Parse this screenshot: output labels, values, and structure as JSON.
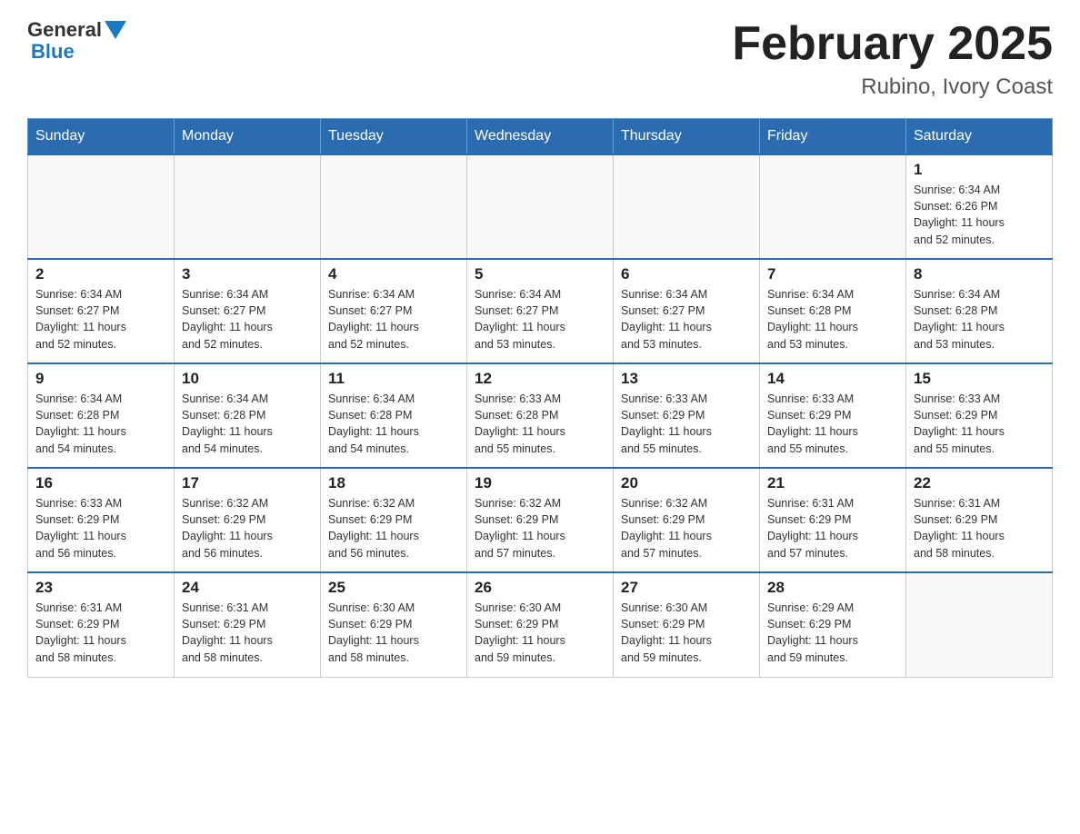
{
  "header": {
    "logo_general": "General",
    "logo_blue": "Blue",
    "month_year": "February 2025",
    "location": "Rubino, Ivory Coast"
  },
  "weekdays": [
    "Sunday",
    "Monday",
    "Tuesday",
    "Wednesday",
    "Thursday",
    "Friday",
    "Saturday"
  ],
  "weeks": [
    [
      {
        "day": "",
        "info": ""
      },
      {
        "day": "",
        "info": ""
      },
      {
        "day": "",
        "info": ""
      },
      {
        "day": "",
        "info": ""
      },
      {
        "day": "",
        "info": ""
      },
      {
        "day": "",
        "info": ""
      },
      {
        "day": "1",
        "info": "Sunrise: 6:34 AM\nSunset: 6:26 PM\nDaylight: 11 hours\nand 52 minutes."
      }
    ],
    [
      {
        "day": "2",
        "info": "Sunrise: 6:34 AM\nSunset: 6:27 PM\nDaylight: 11 hours\nand 52 minutes."
      },
      {
        "day": "3",
        "info": "Sunrise: 6:34 AM\nSunset: 6:27 PM\nDaylight: 11 hours\nand 52 minutes."
      },
      {
        "day": "4",
        "info": "Sunrise: 6:34 AM\nSunset: 6:27 PM\nDaylight: 11 hours\nand 52 minutes."
      },
      {
        "day": "5",
        "info": "Sunrise: 6:34 AM\nSunset: 6:27 PM\nDaylight: 11 hours\nand 53 minutes."
      },
      {
        "day": "6",
        "info": "Sunrise: 6:34 AM\nSunset: 6:27 PM\nDaylight: 11 hours\nand 53 minutes."
      },
      {
        "day": "7",
        "info": "Sunrise: 6:34 AM\nSunset: 6:28 PM\nDaylight: 11 hours\nand 53 minutes."
      },
      {
        "day": "8",
        "info": "Sunrise: 6:34 AM\nSunset: 6:28 PM\nDaylight: 11 hours\nand 53 minutes."
      }
    ],
    [
      {
        "day": "9",
        "info": "Sunrise: 6:34 AM\nSunset: 6:28 PM\nDaylight: 11 hours\nand 54 minutes."
      },
      {
        "day": "10",
        "info": "Sunrise: 6:34 AM\nSunset: 6:28 PM\nDaylight: 11 hours\nand 54 minutes."
      },
      {
        "day": "11",
        "info": "Sunrise: 6:34 AM\nSunset: 6:28 PM\nDaylight: 11 hours\nand 54 minutes."
      },
      {
        "day": "12",
        "info": "Sunrise: 6:33 AM\nSunset: 6:28 PM\nDaylight: 11 hours\nand 55 minutes."
      },
      {
        "day": "13",
        "info": "Sunrise: 6:33 AM\nSunset: 6:29 PM\nDaylight: 11 hours\nand 55 minutes."
      },
      {
        "day": "14",
        "info": "Sunrise: 6:33 AM\nSunset: 6:29 PM\nDaylight: 11 hours\nand 55 minutes."
      },
      {
        "day": "15",
        "info": "Sunrise: 6:33 AM\nSunset: 6:29 PM\nDaylight: 11 hours\nand 55 minutes."
      }
    ],
    [
      {
        "day": "16",
        "info": "Sunrise: 6:33 AM\nSunset: 6:29 PM\nDaylight: 11 hours\nand 56 minutes."
      },
      {
        "day": "17",
        "info": "Sunrise: 6:32 AM\nSunset: 6:29 PM\nDaylight: 11 hours\nand 56 minutes."
      },
      {
        "day": "18",
        "info": "Sunrise: 6:32 AM\nSunset: 6:29 PM\nDaylight: 11 hours\nand 56 minutes."
      },
      {
        "day": "19",
        "info": "Sunrise: 6:32 AM\nSunset: 6:29 PM\nDaylight: 11 hours\nand 57 minutes."
      },
      {
        "day": "20",
        "info": "Sunrise: 6:32 AM\nSunset: 6:29 PM\nDaylight: 11 hours\nand 57 minutes."
      },
      {
        "day": "21",
        "info": "Sunrise: 6:31 AM\nSunset: 6:29 PM\nDaylight: 11 hours\nand 57 minutes."
      },
      {
        "day": "22",
        "info": "Sunrise: 6:31 AM\nSunset: 6:29 PM\nDaylight: 11 hours\nand 58 minutes."
      }
    ],
    [
      {
        "day": "23",
        "info": "Sunrise: 6:31 AM\nSunset: 6:29 PM\nDaylight: 11 hours\nand 58 minutes."
      },
      {
        "day": "24",
        "info": "Sunrise: 6:31 AM\nSunset: 6:29 PM\nDaylight: 11 hours\nand 58 minutes."
      },
      {
        "day": "25",
        "info": "Sunrise: 6:30 AM\nSunset: 6:29 PM\nDaylight: 11 hours\nand 58 minutes."
      },
      {
        "day": "26",
        "info": "Sunrise: 6:30 AM\nSunset: 6:29 PM\nDaylight: 11 hours\nand 59 minutes."
      },
      {
        "day": "27",
        "info": "Sunrise: 6:30 AM\nSunset: 6:29 PM\nDaylight: 11 hours\nand 59 minutes."
      },
      {
        "day": "28",
        "info": "Sunrise: 6:29 AM\nSunset: 6:29 PM\nDaylight: 11 hours\nand 59 minutes."
      },
      {
        "day": "",
        "info": ""
      }
    ]
  ]
}
